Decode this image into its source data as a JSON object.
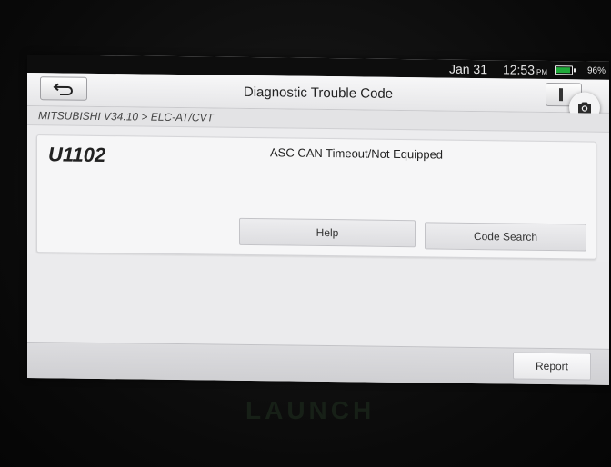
{
  "status_bar": {
    "date": "Jan 31",
    "time": "12:53",
    "meridiem": "PM",
    "battery": "96%",
    "battery_color": "#1faa3a"
  },
  "header": {
    "title": "Diagnostic Trouble Code",
    "back_icon": "back-arrow-icon",
    "camera_icon": "camera-icon"
  },
  "breadcrumb": "MITSUBISHI V34.10 > ELC-AT/CVT",
  "dtc": {
    "code": "U1102",
    "description": "ASC CAN Timeout/Not Equipped",
    "help_label": "Help",
    "code_search_label": "Code Search"
  },
  "footer": {
    "report_label": "Report"
  },
  "device": {
    "brand": "LAUNCH"
  }
}
